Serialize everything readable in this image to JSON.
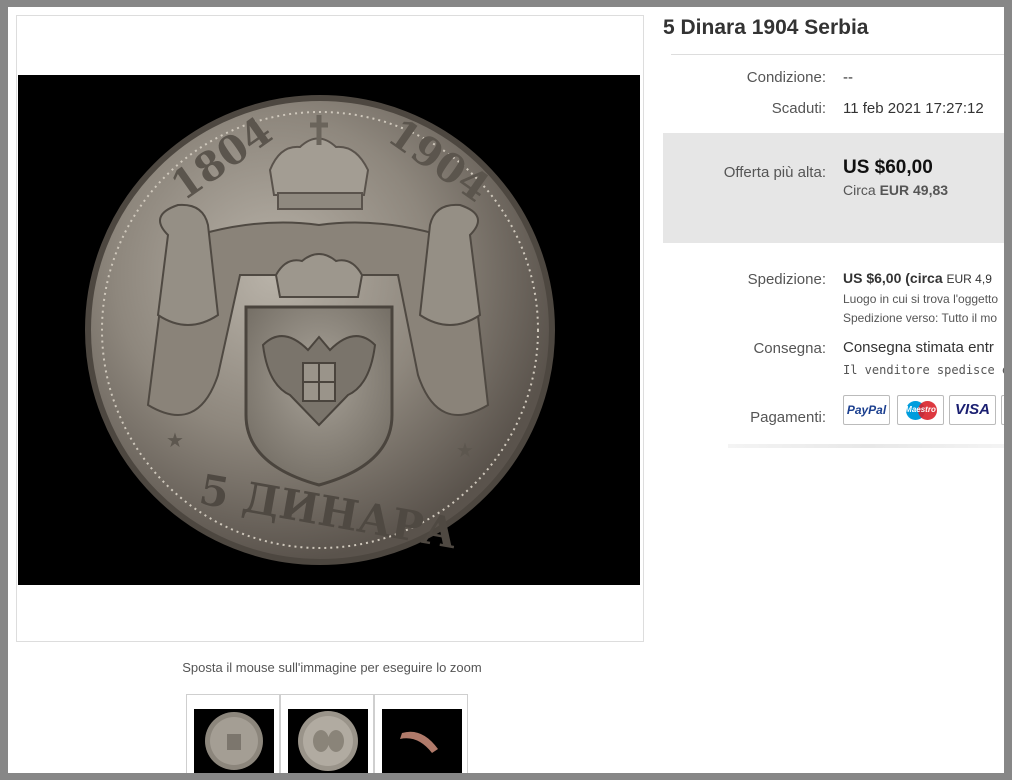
{
  "listing": {
    "title": "5 Dinara 1904 Serbia",
    "image_alt": "Moneta d'argento 5 Dinara 1904 Serbia, rovescio con stemma",
    "coin_years": [
      "1804",
      "1904"
    ],
    "coin_denomination": "5 ДИНАРА"
  },
  "details": {
    "condition_label": "Condizione:",
    "condition_value": "--",
    "ended_label": "Scaduti:",
    "ended_value": "11 feb 2021   17:27:12",
    "bid_label": "Offerta più alta:",
    "bid_value": "US $60,00",
    "bid_approx_prefix": "Circa",
    "bid_approx_value": "EUR 49,83",
    "shipping_label": "Spedizione:",
    "shipping_value": "US $6,00",
    "shipping_approx_open": "(circa",
    "shipping_approx_value": "EUR 4,9",
    "shipping_location": "Luogo in cui si trova l'oggetto",
    "shipping_to_label": "Spedizione verso:",
    "shipping_to_value": "Tutto il mo",
    "delivery_label": "Consegna:",
    "delivery_value": "Consegna stimata entr",
    "delivery_sub": "Il venditore spedisce entr",
    "payments_label": "Pagamenti:"
  },
  "payments": [
    {
      "name": "paypal-icon",
      "label": "PayPal"
    },
    {
      "name": "maestro-icon",
      "label": "Maestro"
    },
    {
      "name": "visa-icon",
      "label": "VISA"
    }
  ],
  "gallery": {
    "zoom_hint": "Sposta il mouse sull'immagine per eseguire lo zoom"
  },
  "colors": {
    "frame": "#878787",
    "bid_box": "#e6e6e6",
    "paypal": "#1b3f8f",
    "maestro_red": "#d9222a",
    "maestro_blue": "#009ddd",
    "visa": "#1a1f71"
  }
}
